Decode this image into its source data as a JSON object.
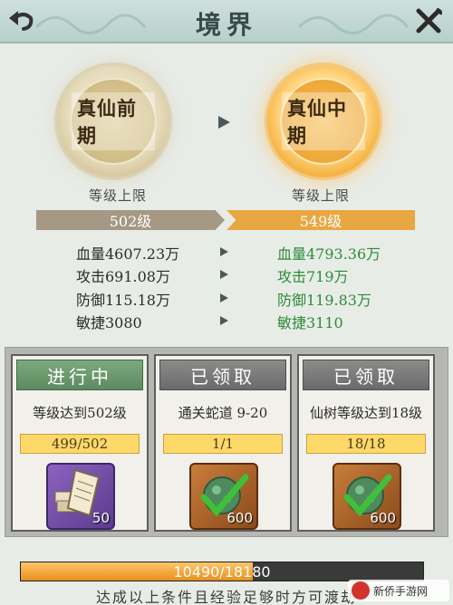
{
  "header": {
    "title": "境界"
  },
  "realm": {
    "current": "真仙前期",
    "next": "真仙中期"
  },
  "level_cap": {
    "label": "等级上限",
    "current": "502级",
    "next": "549级"
  },
  "stats": [
    {
      "current": "血量4607.23万",
      "next": "血量4793.36万"
    },
    {
      "current": "攻击691.08万",
      "next": "攻击719万"
    },
    {
      "current": "防御115.18万",
      "next": "防御119.83万"
    },
    {
      "current": "敏捷3080",
      "next": "敏捷3110"
    }
  ],
  "tasks": [
    {
      "status": "进行中",
      "task": "等级达到502级",
      "progress": "499/502",
      "reward_count": "50"
    },
    {
      "status": "已领取",
      "task": "通关蛇道 9-20",
      "progress": "1/1",
      "reward_count": "600"
    },
    {
      "status": "已领取",
      "task": "仙树等级达到18级",
      "progress": "18/18",
      "reward_count": "600"
    }
  ],
  "experience": {
    "text": "10490/18180",
    "fraction": 0.577
  },
  "footer": {
    "text": "达成以上条件且经验足够时方可渡劫"
  },
  "watermark": {
    "text": "新侨手游网"
  },
  "colors": {
    "accent": "#e9a742",
    "green": "#2e8a3a",
    "active": "#6b9a6e"
  }
}
